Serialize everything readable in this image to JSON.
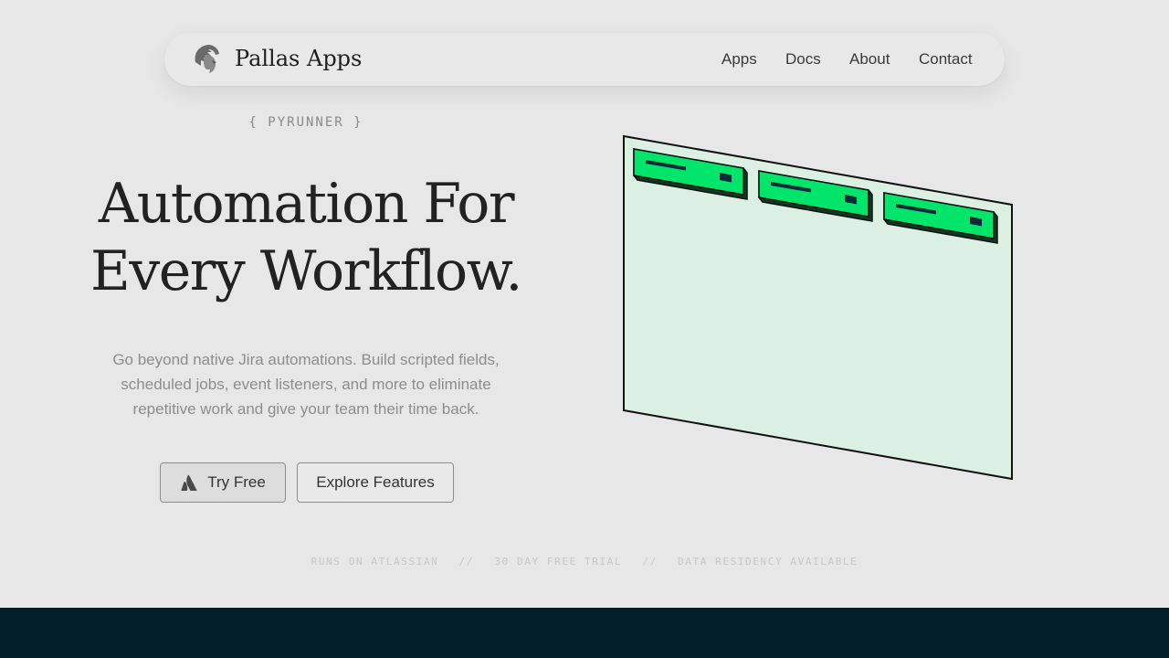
{
  "brand": {
    "name": "Pallas Apps",
    "logo_icon": "greek-helmet-head-icon"
  },
  "nav": {
    "links": [
      "Apps",
      "Docs",
      "About",
      "Contact"
    ]
  },
  "hero": {
    "eyebrow": "{ PYRUNNER }",
    "headline_line1": "Automation For",
    "headline_line2": "Every Workflow.",
    "description": "Go beyond native Jira automations. Build scripted fields, scheduled jobs, event listeners, and more to eliminate repetitive work and give your team their time back.",
    "buttons": {
      "try_free": "Try Free",
      "try_free_icon": "atlassian-icon",
      "explore": "Explore Features"
    }
  },
  "trust": {
    "items": [
      "RUNS ON ATLASSIAN",
      "30 DAY FREE TRIAL",
      "DATA RESIDENCY AVAILABLE"
    ],
    "separator": "//"
  },
  "colors": {
    "background": "#e7e7e7",
    "accent_green": "#00e56a",
    "panel_fill": "#dcefe3",
    "dark_band": "#011e2a"
  }
}
